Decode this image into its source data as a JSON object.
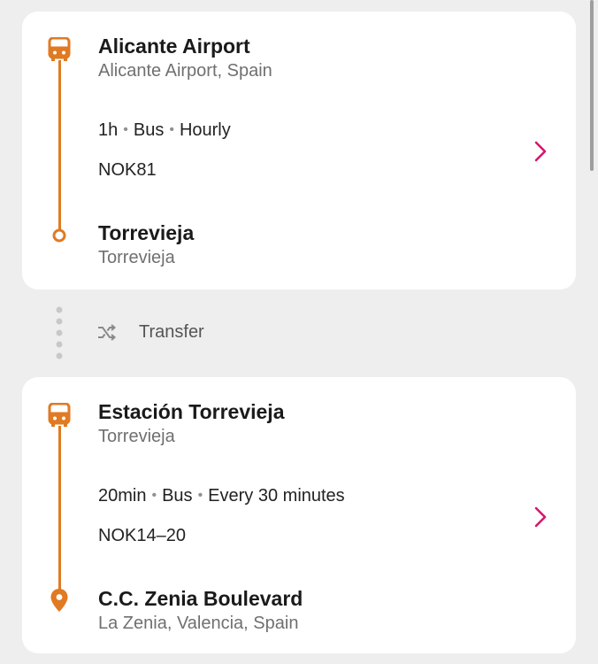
{
  "accent_color": "#e07a23",
  "chevron_color": "#d6166f",
  "legs": [
    {
      "origin": {
        "name": "Alicante Airport",
        "subtitle": "Alicante Airport, Spain"
      },
      "duration": "1h",
      "mode": "Bus",
      "frequency": "Hourly",
      "route_code": "NOK81",
      "destination": {
        "name": "Torrevieja",
        "subtitle": "Torrevieja"
      },
      "mode_icon": "bus-icon",
      "destination_icon": "circle-stop-icon"
    },
    {
      "origin": {
        "name": "Estación Torrevieja",
        "subtitle": "Torrevieja"
      },
      "duration": "20min",
      "mode": "Bus",
      "frequency": "Every 30 minutes",
      "route_code": "NOK14–20",
      "destination": {
        "name": "C.C. Zenia Boulevard",
        "subtitle": "La Zenia, Valencia, Spain"
      },
      "mode_icon": "bus-icon",
      "destination_icon": "location-pin-icon"
    }
  ],
  "transfer": {
    "label": "Transfer",
    "icon": "shuffle-icon"
  }
}
